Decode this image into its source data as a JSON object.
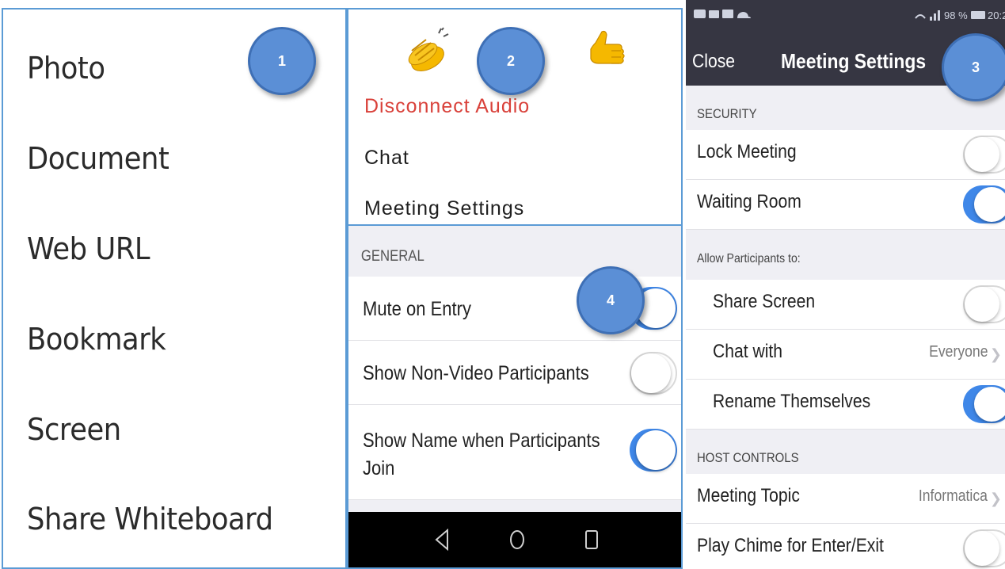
{
  "callouts": [
    "1",
    "2",
    "3",
    "4"
  ],
  "share_menu": {
    "items": [
      "Photo",
      "Document",
      "Web URL",
      "Bookmark",
      "Screen",
      "Share Whiteboard"
    ]
  },
  "meeting_menu": {
    "reactions": [
      "clapping-hands-icon",
      "thumbs-up-icon"
    ],
    "disconnect_audio": "Disconnect Audio",
    "chat": "Chat",
    "meeting_settings": "Meeting Settings",
    "disconnect_color": "#d9413a"
  },
  "general_settings": {
    "section": "GENERAL",
    "rows": [
      {
        "label": "Mute on Entry",
        "toggle": "on"
      },
      {
        "label": "Show Non-Video Participants",
        "toggle": "off"
      },
      {
        "label_line1": "Show Name when Participants",
        "label_line2": "Join",
        "toggle": "on"
      }
    ],
    "nav_icons": [
      "back-triangle-icon",
      "home-circle-icon",
      "recents-square-icon"
    ]
  },
  "phone_settings": {
    "status_bar": {
      "left_icons": [
        "volte-icon",
        "cast-icon",
        "gallery-icon",
        "cloud-icon"
      ],
      "battery_text": "98 %",
      "time": "20:2"
    },
    "header": {
      "close": "Close",
      "title": "Meeting Settings"
    },
    "security_section": "SECURITY",
    "security_rows": [
      {
        "label": "Lock Meeting",
        "toggle": "off"
      },
      {
        "label": "Waiting Room",
        "toggle": "on"
      }
    ],
    "allow_section": "Allow Participants to:",
    "allow_rows": [
      {
        "label": "Share Screen",
        "toggle": "off"
      },
      {
        "label": "Chat with",
        "value": "Everyone"
      },
      {
        "label": "Rename Themselves",
        "toggle": "on"
      }
    ],
    "host_section": "HOST CONTROLS",
    "host_rows": [
      {
        "label": "Meeting Topic",
        "value": "Informatica"
      },
      {
        "label": "Play Chime for Enter/Exit",
        "toggle": "off"
      }
    ]
  },
  "colors": {
    "accent": "#3f87e8",
    "callout": "#5b8fd6",
    "panel_border": "#5b9bd5",
    "header_bg": "#363642"
  }
}
